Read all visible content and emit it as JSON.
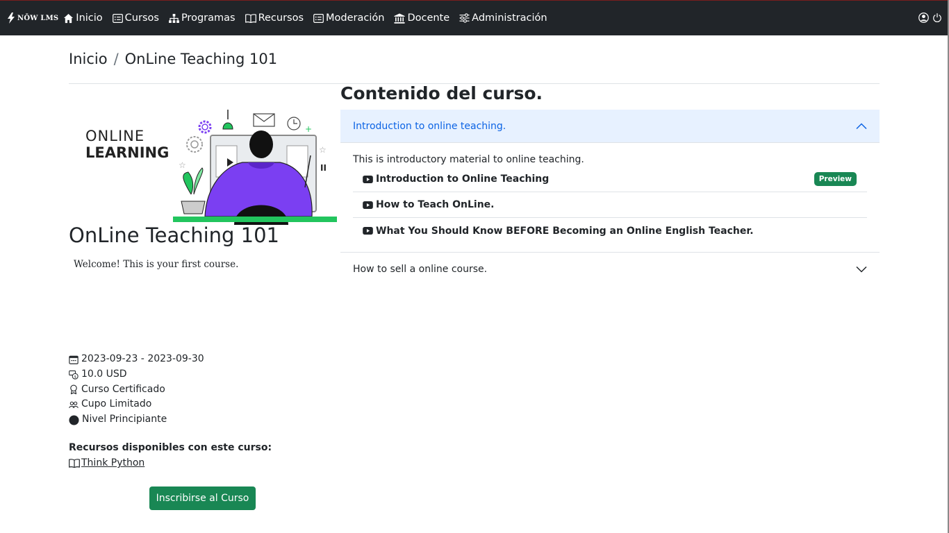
{
  "navbar": {
    "brand": "NŌW LMS",
    "items": [
      {
        "label": "Inicio",
        "icon": "house-icon"
      },
      {
        "label": "Cursos",
        "icon": "card-list-icon"
      },
      {
        "label": "Programas",
        "icon": "diagram-icon"
      },
      {
        "label": "Recursos",
        "icon": "book-icon"
      },
      {
        "label": "Moderación",
        "icon": "card-list-icon"
      },
      {
        "label": "Docente",
        "icon": "bank-icon"
      },
      {
        "label": "Administración",
        "icon": "sliders-icon"
      }
    ],
    "right_icons": [
      "user-circle-icon",
      "power-icon"
    ]
  },
  "breadcrumb": {
    "home": "Inicio",
    "separator": "/",
    "current": "OnLine Teaching 101"
  },
  "hero": {
    "line1": "ONLINE",
    "line2": "LEARNING"
  },
  "course": {
    "title": "OnLine Teaching 101",
    "description": "Welcome! This is your first course.",
    "dates": "2023-09-23 - 2023-09-30",
    "price": "10.0 USD",
    "certified": "Curso Certificado",
    "limited": "Cupo Limitado",
    "level": "Nivel Principiante"
  },
  "resources": {
    "title": "Recursos disponibles con este curso:",
    "items": [
      "Think Python"
    ]
  },
  "enroll_button": "Inscribirse al Curso",
  "content": {
    "title": "Contenido del curso.",
    "sections": [
      {
        "title": "Introduction to online teaching.",
        "expanded": true,
        "description": "This is introductory material to online teaching.",
        "lessons": [
          {
            "title": "Introduction to Online Teaching",
            "badge": "Preview"
          },
          {
            "title": "How to Teach OnLine."
          },
          {
            "title": "What You Should Know BEFORE Becoming an Online English Teacher."
          }
        ]
      },
      {
        "title": "How to sell a online course.",
        "expanded": false
      }
    ]
  },
  "colors": {
    "navbar": "#212529",
    "accent_green": "#198754",
    "accordion_active_bg": "#e7f1ff",
    "accordion_active_text": "#0c63e4",
    "hero_purple": "#7b3ff2"
  }
}
